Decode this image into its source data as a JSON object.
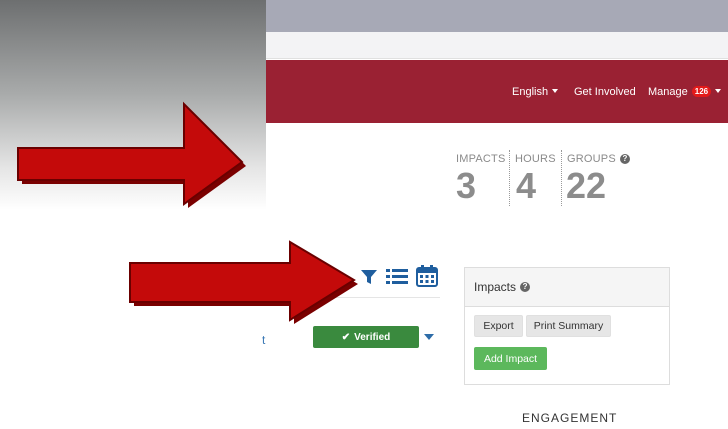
{
  "nav": {
    "language": "English",
    "get_involved": "Get Involved",
    "manage": "Manage",
    "manage_badge": "126"
  },
  "stats": {
    "impacts_label": "IMPACTS",
    "impacts_value": "3",
    "hours_label": "HOURS",
    "hours_value": "4",
    "groups_label": "GROUPS",
    "groups_value": "22",
    "help_glyph": "?"
  },
  "toolbar": {
    "icons": [
      "filter-icon",
      "list-icon",
      "calendar-icon"
    ]
  },
  "row": {
    "link_fragment": "t",
    "verified_check": "✔",
    "verified_label": "Verified"
  },
  "impacts_panel": {
    "title": "Impacts",
    "help_glyph": "?",
    "export_label": "Export",
    "print_summary_label": "Print Summary",
    "add_impact_label": "Add Impact"
  },
  "engagement_heading": "ENGAGEMENT",
  "colors": {
    "navbar": "#9a2133",
    "badge": "#e31a1a",
    "verified": "#3a8a3e",
    "add_impact": "#5cb85c",
    "icon_blue": "#1f5e9e",
    "arrow_red": "#c40a0a"
  }
}
